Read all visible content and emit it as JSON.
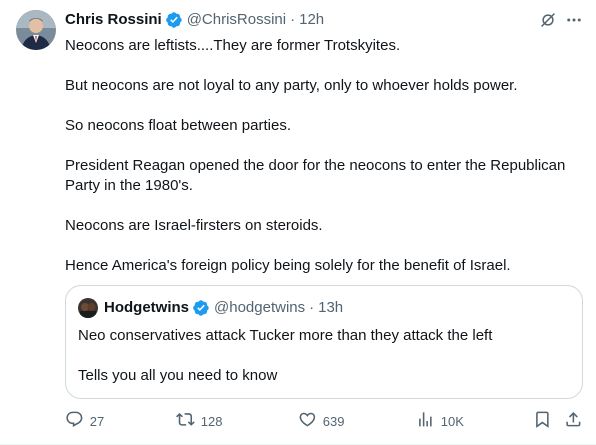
{
  "author": {
    "name": "Chris Rossini",
    "handle": "@ChrisRossini",
    "separator": "·",
    "time": "12h"
  },
  "tweet": {
    "paragraphs": [
      "Neocons are leftists....They are former Trotskyites.",
      "But neocons are not loyal to any party, only to whoever holds power.",
      "So neocons float between parties.",
      "President Reagan opened the door for the neocons to enter the Republican Party in the 1980's.",
      "Neocons are Israel-firsters on steroids.",
      "Hence America's foreign policy being solely for the benefit of Israel."
    ]
  },
  "quote": {
    "name": "Hodgetwins",
    "handle": "@hodgetwins",
    "separator": "·",
    "time": "13h",
    "paragraphs": [
      "Neo conservatives attack Tucker more than they attack the left",
      "Tells you all you need to know"
    ]
  },
  "actions": {
    "replies": "27",
    "retweets": "128",
    "likes": "639",
    "views": "10K"
  },
  "icons": {
    "verified": "verified-badge-icon",
    "grok": "grok-icon",
    "more": "more-icon",
    "reply": "reply-icon",
    "retweet": "retweet-icon",
    "like": "like-icon",
    "views": "views-icon",
    "bookmark": "bookmark-icon",
    "share": "share-icon"
  },
  "colors": {
    "verified": "#1d9bf0",
    "text": "#0f1419",
    "secondary": "#536471",
    "border": "#cfd9de"
  }
}
